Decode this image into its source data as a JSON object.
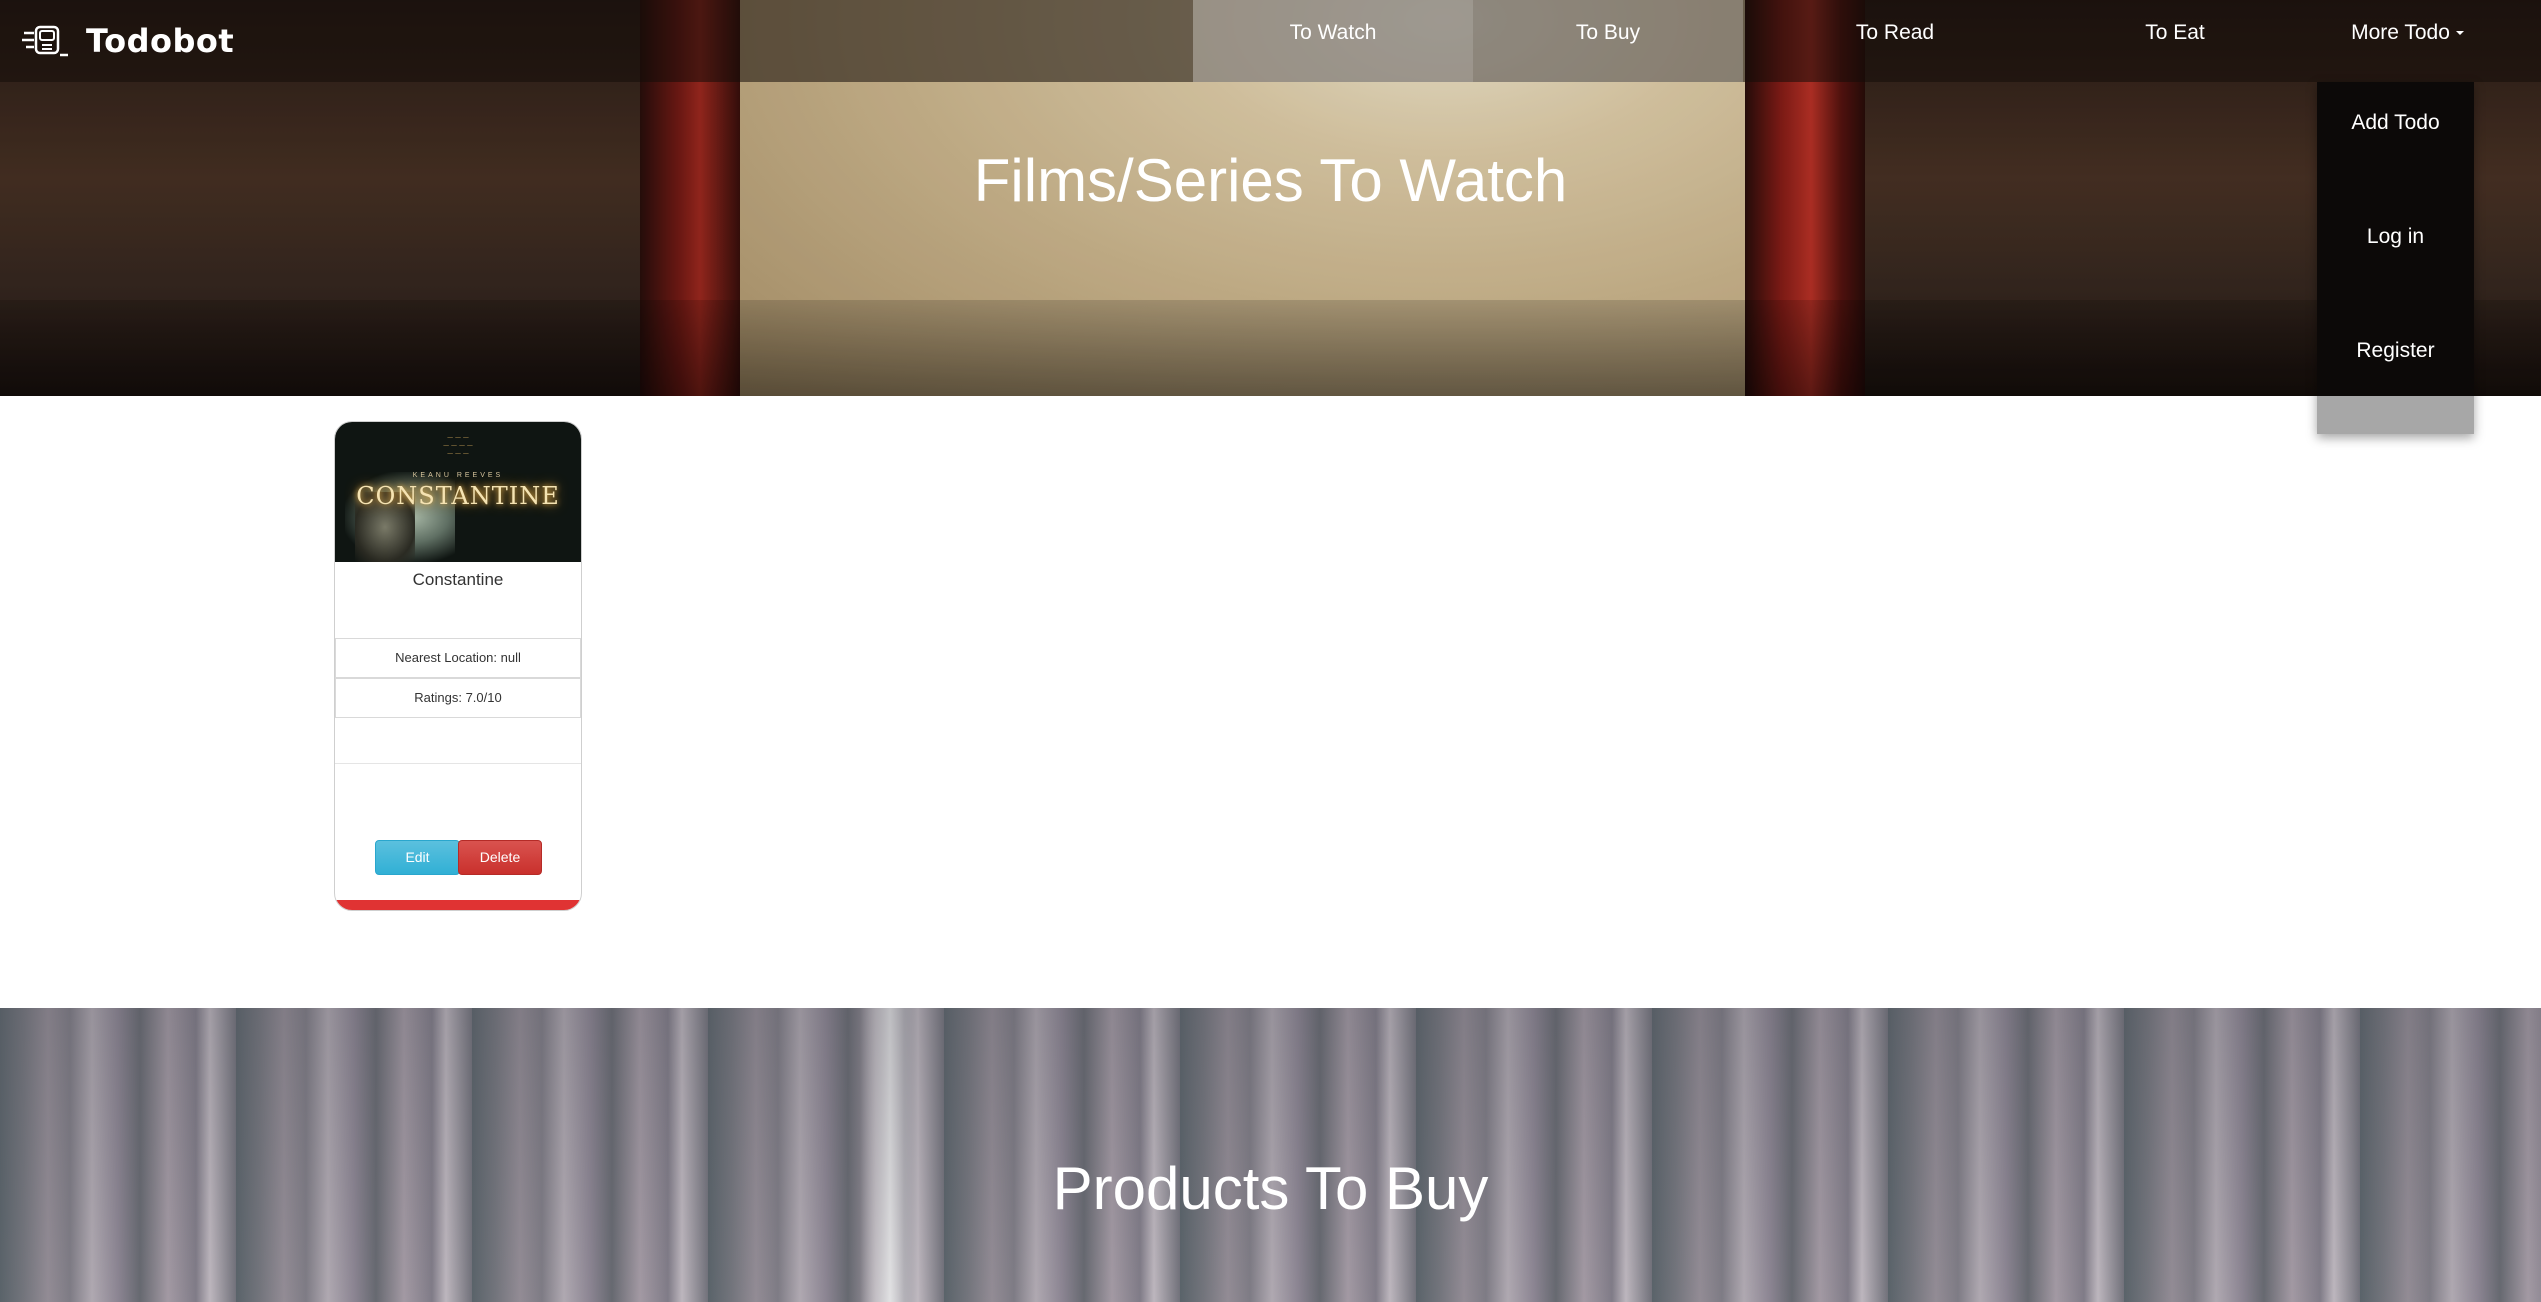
{
  "navbar": {
    "brand": "Todobot",
    "items": [
      {
        "label": "To Watch"
      },
      {
        "label": "To Buy"
      },
      {
        "label": "To Read"
      },
      {
        "label": "To Eat"
      }
    ],
    "more_label": "More Todo",
    "dropdown": [
      "Add Todo",
      "Log in",
      "Register"
    ]
  },
  "sections": [
    {
      "title": "Films/Series To Watch"
    },
    {
      "title": "Products To Buy"
    }
  ],
  "card": {
    "poster_title": "CONSTANTINE",
    "poster_credit": "KEANU REEVES",
    "title": "Constantine",
    "location": "Nearest Location: null",
    "ratings": "Ratings: 7.0/10",
    "edit_label": "Edit",
    "delete_label": "Delete"
  },
  "colors": {
    "edit": "#5bc0de",
    "delete": "#d9534f",
    "card_bar": "#e03333"
  }
}
